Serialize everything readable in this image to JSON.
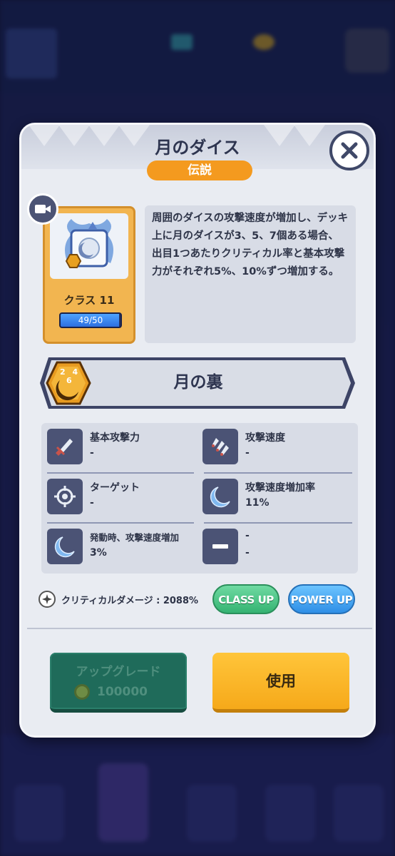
{
  "dialog": {
    "title": "月のダイス",
    "rarity": "伝説"
  },
  "dice": {
    "class_label": "クラス 11",
    "progress_text": "49/50",
    "progress_fraction": 0.98
  },
  "description": "周囲のダイスの攻撃速度が増加し、デッキ上に月のダイスが3、5、7個ある場合、出目1つあたりクリティカル率と基本攻撃力がそれぞれ5%、10%ずつ増加する。",
  "skill": {
    "name": "月の裏",
    "badge_numbers": [
      "2",
      "4",
      "6"
    ]
  },
  "stats": [
    {
      "label": "基本攻撃力",
      "value": "-",
      "icon": "sword-icon"
    },
    {
      "label": "攻撃速度",
      "value": "-",
      "icon": "attack-speed-icon"
    },
    {
      "label": "ターゲット",
      "value": "-",
      "icon": "target-icon"
    },
    {
      "label": "攻撃速度増加率",
      "value": "11%",
      "icon": "crescent-moon-icon"
    },
    {
      "label": "発動時、攻撃速度増加",
      "value": "3%",
      "icon": "crescent-moon-icon"
    },
    {
      "label": "-",
      "value": "-",
      "icon": "minus-icon"
    }
  ],
  "critical_damage": "クリティカルダメージ : 2088%",
  "buttons": {
    "class_up": "CLASS UP",
    "power_up": "POWER UP",
    "upgrade": "アップグレード",
    "upgrade_cost": "100000",
    "use": "使用"
  },
  "colors": {
    "rarity": "#f49a1f",
    "card": "#f2b550",
    "class_up": "#35b372",
    "power_up": "#2f8fe6",
    "upgrade": "#1f6b5a",
    "use": "#f6a91a"
  }
}
